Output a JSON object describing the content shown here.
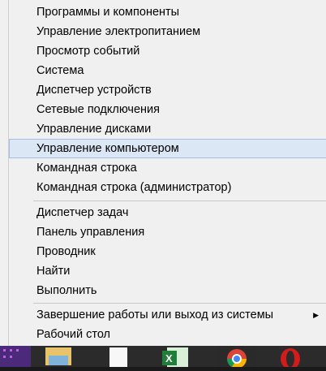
{
  "menu": {
    "group1": [
      {
        "label": "Программы и компоненты"
      },
      {
        "label": "Управление электропитанием"
      },
      {
        "label": "Просмотр событий"
      },
      {
        "label": "Система"
      },
      {
        "label": "Диспетчер устройств"
      },
      {
        "label": "Сетевые подключения"
      },
      {
        "label": "Управление дисками"
      },
      {
        "label": "Управление компьютером",
        "selected": true
      },
      {
        "label": "Командная строка"
      },
      {
        "label": "Командная строка (администратор)"
      }
    ],
    "group2": [
      {
        "label": "Диспетчер задач"
      },
      {
        "label": "Панель управления"
      },
      {
        "label": "Проводник"
      },
      {
        "label": "Найти"
      },
      {
        "label": "Выполнить"
      }
    ],
    "group3": [
      {
        "label": "Завершение работы или выход из системы",
        "has_submenu": true
      },
      {
        "label": "Рабочий стол"
      }
    ]
  },
  "taskbar": {
    "items": [
      {
        "icon": "start-icon"
      },
      {
        "icon": "file-explorer-icon"
      },
      {
        "icon": "document-icon"
      },
      {
        "icon": "excel-icon"
      },
      {
        "icon": "chrome-icon"
      },
      {
        "icon": "opera-icon"
      }
    ]
  },
  "colors": {
    "menu_bg": "#f0f0f0",
    "selection_bg": "#dbe7f5",
    "selection_border": "#9fbfe6",
    "taskbar_bg": "#2b2b2b"
  }
}
